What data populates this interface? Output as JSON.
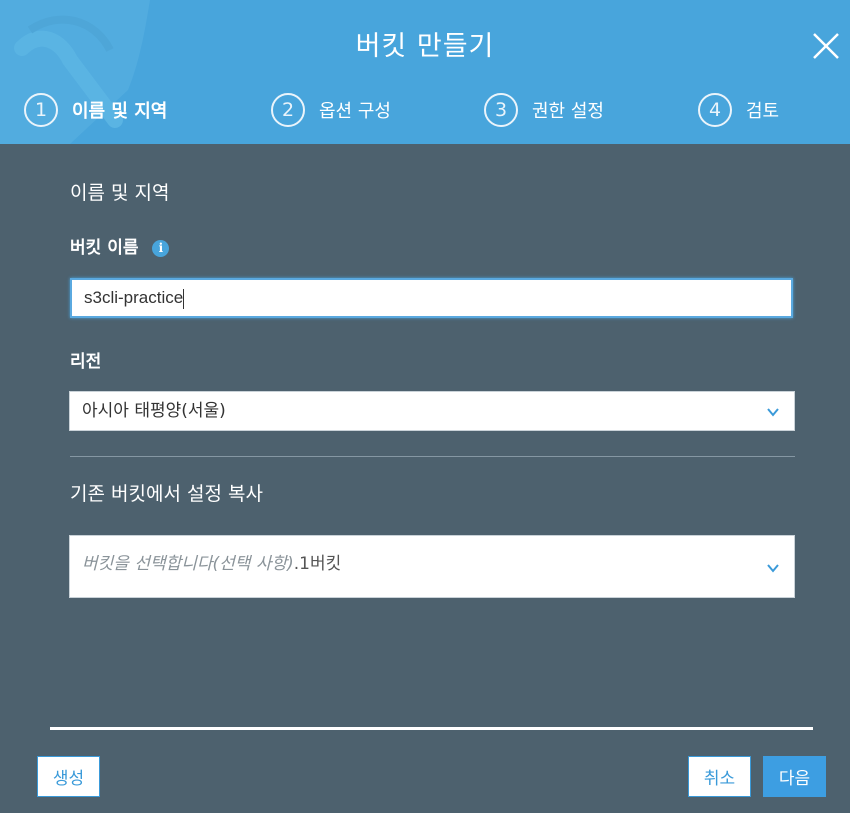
{
  "dialog": {
    "title": "버킷 만들기"
  },
  "steps": [
    {
      "number": "1",
      "label": "이름 및 지역",
      "active": true
    },
    {
      "number": "2",
      "label": "옵션 구성",
      "active": false
    },
    {
      "number": "3",
      "label": "권한 설정",
      "active": false
    },
    {
      "number": "4",
      "label": "검토",
      "active": false
    }
  ],
  "form": {
    "section_title": "이름 및 지역",
    "bucket_name_label": "버킷 이름",
    "bucket_name_value": "s3cli-practice",
    "region_label": "리전",
    "region_value": "아시아 태평양(서울)",
    "copy_section_title": "기존 버킷에서 설정 복사",
    "copy_placeholder": "버킷을 선택합니다(선택 사항)",
    "copy_count": ".1버킷"
  },
  "footer": {
    "create_label": "생성",
    "cancel_label": "취소",
    "next_label": "다음"
  },
  "colors": {
    "header": "#48a5dc",
    "body": "#4d616e",
    "primary": "#3d9ee2"
  },
  "icons": {
    "close": "close-icon",
    "info": "info-icon",
    "chevron": "chevron-down-icon"
  }
}
